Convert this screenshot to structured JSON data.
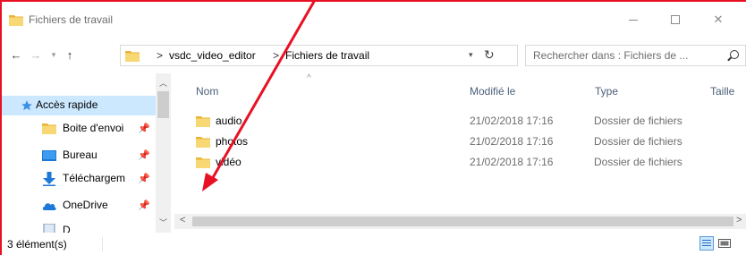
{
  "window": {
    "title": "Fichiers de travail"
  },
  "address": {
    "segments": [
      "vsdc_video_editor",
      "Fichiers de travail"
    ],
    "separator": ">"
  },
  "search": {
    "placeholder": "Rechercher dans : Fichiers de ..."
  },
  "nav_pane": {
    "items": [
      {
        "label": "Accès rapide",
        "icon": "star-icon",
        "selected": true,
        "pinned": false
      },
      {
        "label": "Boite d'envoi",
        "icon": "folder-icon",
        "selected": false,
        "pinned": true
      },
      {
        "label": "Bureau",
        "icon": "desktop-icon",
        "selected": false,
        "pinned": true
      },
      {
        "label": "Téléchargem",
        "icon": "download-icon",
        "selected": false,
        "pinned": true
      },
      {
        "label": "OneDrive",
        "icon": "cloud-icon",
        "selected": false,
        "pinned": true
      },
      {
        "label": "D",
        "icon": "documents-icon",
        "selected": false,
        "pinned": false
      }
    ]
  },
  "columns": {
    "name": "Nom",
    "modified": "Modifié le",
    "type": "Type",
    "size": "Taille"
  },
  "files": [
    {
      "name": "audio",
      "modified": "21/02/2018 17:16",
      "type": "Dossier de fichiers"
    },
    {
      "name": "photos",
      "modified": "21/02/2018 17:16",
      "type": "Dossier de fichiers"
    },
    {
      "name": "vidéo",
      "modified": "21/02/2018 17:16",
      "type": "Dossier de fichiers"
    }
  ],
  "status": {
    "count": "3 élément(s)"
  },
  "colors": {
    "accent_red": "#e81123",
    "folder_yellow": "#f8d775",
    "selection_blue": "#cce8ff",
    "header_text": "#4c607a"
  }
}
